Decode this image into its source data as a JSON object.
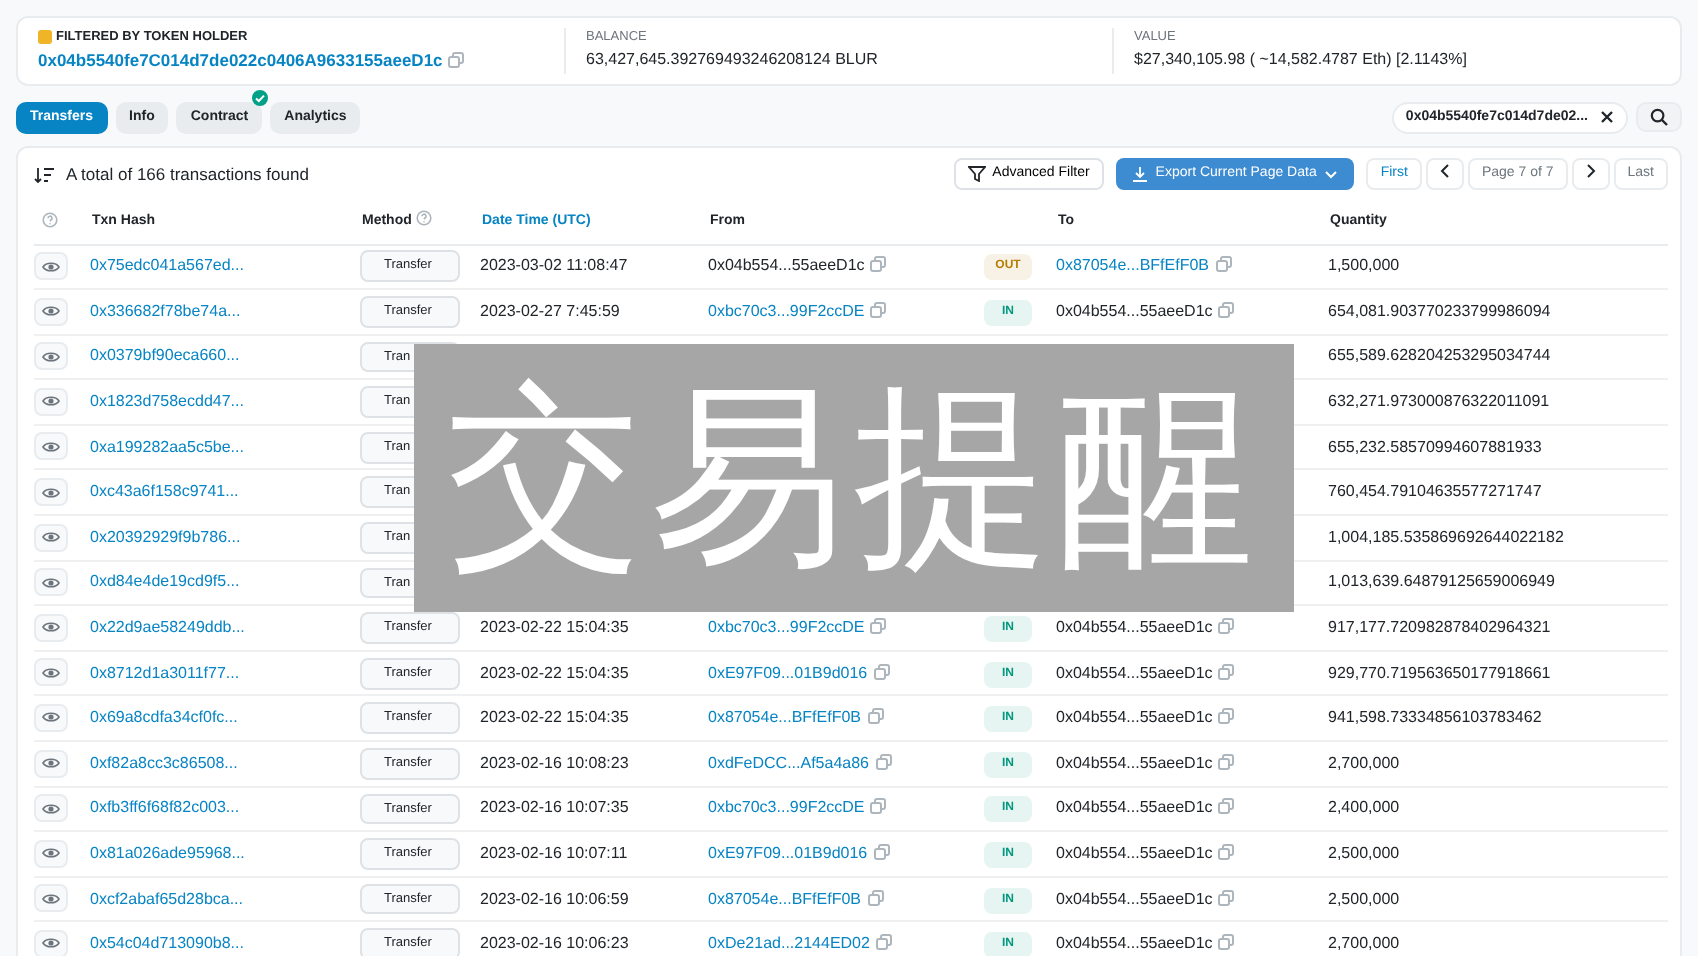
{
  "header": {
    "filter_label": "FILTERED BY TOKEN HOLDER",
    "address": "0x04b5540fe7C014d7de022c0406A9633155aeeD1c",
    "balance_label": "BALANCE",
    "balance": "63,427,645.392769493246208124 BLUR",
    "value_label": "VALUE",
    "value": "$27,340,105.98 ( ~14,582.4787 Eth) [2.1143%]"
  },
  "tabs": [
    {
      "label": "Transfers",
      "selected": true,
      "verified": false
    },
    {
      "label": "Info",
      "selected": false,
      "verified": false
    },
    {
      "label": "Contract",
      "selected": false,
      "verified": true
    },
    {
      "label": "Analytics",
      "selected": false,
      "verified": false
    }
  ],
  "filter_chip": "0x04b5540fe7c014d7de02...",
  "summary": "A total of 166 transactions found",
  "advanced_filter": "Advanced Filter",
  "export": "Export Current Page Data",
  "pager": {
    "first": "First",
    "page": "Page 7 of 7",
    "last": "Last"
  },
  "columns": [
    "Txn Hash",
    "Method",
    "Date Time (UTC)",
    "From",
    "To",
    "Quantity"
  ],
  "rows": [
    {
      "hash": "0x75edc041a567ed...",
      "method": "Transfer",
      "date": "2023-03-02 11:08:47",
      "from": "0x04b554...55aeeD1c",
      "from_link": false,
      "color": "#b47d00",
      "direction": "OUT",
      "to": "0x87054e...BFfEfF0B",
      "to_link": true,
      "quantity": "1,500,000"
    },
    {
      "hash": "0x336682f78be74a...",
      "method": "Transfer",
      "date": "2023-02-27 7:45:59",
      "from": "0xbc70c3...99F2ccDE",
      "from_link": true,
      "color": "#02977e",
      "direction": "IN",
      "to": "0x04b554...55aeeD1c",
      "to_link": false,
      "quantity": "654,081.903770233799986094"
    },
    {
      "hash": "0x0379bf90eca660...",
      "method": "Tran",
      "quantity": "655,589.628204253295034744"
    },
    {
      "hash": "0x1823d758ecdd47...",
      "method": "Tran",
      "quantity": "632,271.973000876322011091"
    },
    {
      "hash": "0xa199282aa5c5be...",
      "method": "Tran",
      "quantity": "655,232.58570994607881933"
    },
    {
      "hash": "0xc43a6f158c9741...",
      "method": "Tran",
      "quantity": "760,454.79104635577271747"
    },
    {
      "hash": "0x20392929f9b786...",
      "method": "Tran",
      "quantity": "1,004,185.535869692644022182"
    },
    {
      "hash": "0xd84e4de19cd9f5...",
      "method": "Tran",
      "quantity": "1,013,639.64879125659006949"
    },
    {
      "hash": "0x22d9ae58249ddb...",
      "method": "Transfer",
      "date": "2023-02-22 15:04:35",
      "from": "0xbc70c3...99F2ccDE",
      "from_link": true,
      "color": "#02977e",
      "direction": "IN",
      "to": "0x04b554...55aeeD1c",
      "to_link": false,
      "quantity": "917,177.720982878402964321"
    },
    {
      "hash": "0x8712d1a3011f77...",
      "method": "Transfer",
      "date": "2023-02-22 15:04:35",
      "from": "0xE97F09...01B9d016",
      "from_link": true,
      "color": "#02977e",
      "direction": "IN",
      "to": "0x04b554...55aeeD1c",
      "to_link": false,
      "quantity": "929,770.719563650177918661"
    },
    {
      "hash": "0x69a8cdfa34cf0fc...",
      "method": "Transfer",
      "date": "2023-02-22 15:04:35",
      "from": "0x87054e...BFfEfF0B",
      "from_link": true,
      "color": "#02977e",
      "direction": "IN",
      "to": "0x04b554...55aeeD1c",
      "to_link": false,
      "quantity": "941,598.73334856103783462"
    },
    {
      "hash": "0xf82a8cc3c86508...",
      "method": "Transfer",
      "date": "2023-02-16 10:08:23",
      "from": "0xdFeDCC...Af5a4a86",
      "from_link": true,
      "color": "#02977e",
      "direction": "IN",
      "to": "0x04b554...55aeeD1c",
      "to_link": false,
      "quantity": "2,700,000"
    },
    {
      "hash": "0xfb3ff6f68f82c003...",
      "method": "Transfer",
      "date": "2023-02-16 10:07:35",
      "from": "0xbc70c3...99F2ccDE",
      "from_link": true,
      "color": "#02977e",
      "direction": "IN",
      "to": "0x04b554...55aeeD1c",
      "to_link": false,
      "quantity": "2,400,000"
    },
    {
      "hash": "0x81a026ade95968...",
      "method": "Transfer",
      "date": "2023-02-16 10:07:11",
      "from": "0xE97F09...01B9d016",
      "from_link": true,
      "color": "#02977e",
      "direction": "IN",
      "to": "0x04b554...55aeeD1c",
      "to_link": false,
      "quantity": "2,500,000"
    },
    {
      "hash": "0xcf2abaf65d28bca...",
      "method": "Transfer",
      "date": "2023-02-16 10:06:59",
      "from": "0x87054e...BFfEfF0B",
      "from_link": true,
      "color": "#02977e",
      "direction": "IN",
      "to": "0x04b554...55aeeD1c",
      "to_link": false,
      "quantity": "2,500,000"
    },
    {
      "hash": "0x54c04d713090b8...",
      "method": "Transfer",
      "date": "2023-02-16 10:06:23",
      "from": "0xDe21ad...2144ED02",
      "from_link": true,
      "color": "#02977e",
      "direction": "IN",
      "to": "0x04b554...55aeeD1c",
      "to_link": false,
      "quantity": "2,700,000"
    }
  ],
  "overlay_banner": "交易提醒"
}
